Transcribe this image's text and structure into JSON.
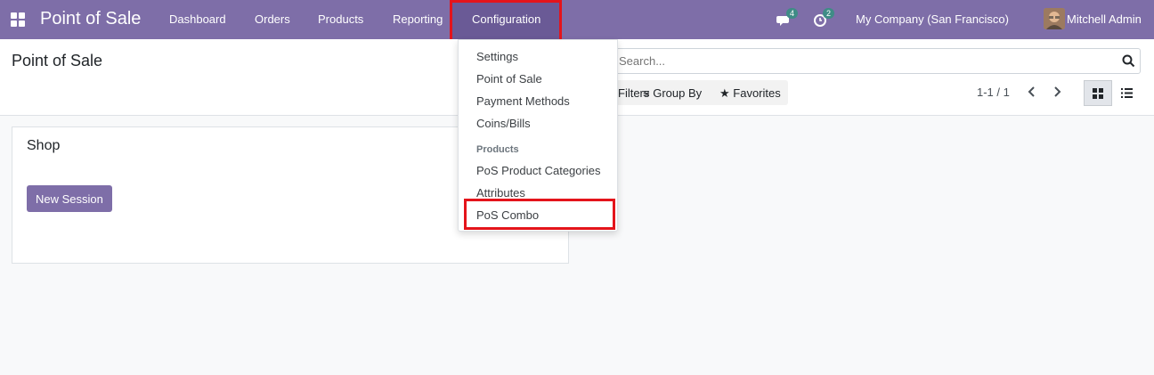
{
  "navbar": {
    "brand": "Point of Sale",
    "menu": [
      "Dashboard",
      "Orders",
      "Products",
      "Reporting",
      "Configuration"
    ],
    "messages_count": "4",
    "activities_count": "2",
    "company": "My Company (San Francisco)",
    "user": "Mitchell Admin",
    "bg_color": "#7e6ea8"
  },
  "control_panel": {
    "title": "Point of Sale",
    "search_placeholder": "Search...",
    "filters_label": "Filters",
    "group_by_label": "Group By",
    "favorites_label": "Favorites",
    "pager": "1-1 / 1"
  },
  "card": {
    "title": "Shop",
    "button": "New Session"
  },
  "dropdown": {
    "items": [
      "Settings",
      "Point of Sale",
      "Payment Methods",
      "Coins/Bills"
    ],
    "section_header": "Products",
    "product_items": [
      "PoS Product Categories",
      "Attributes",
      "PoS Combo"
    ]
  },
  "highlight_color": "#e4141b"
}
